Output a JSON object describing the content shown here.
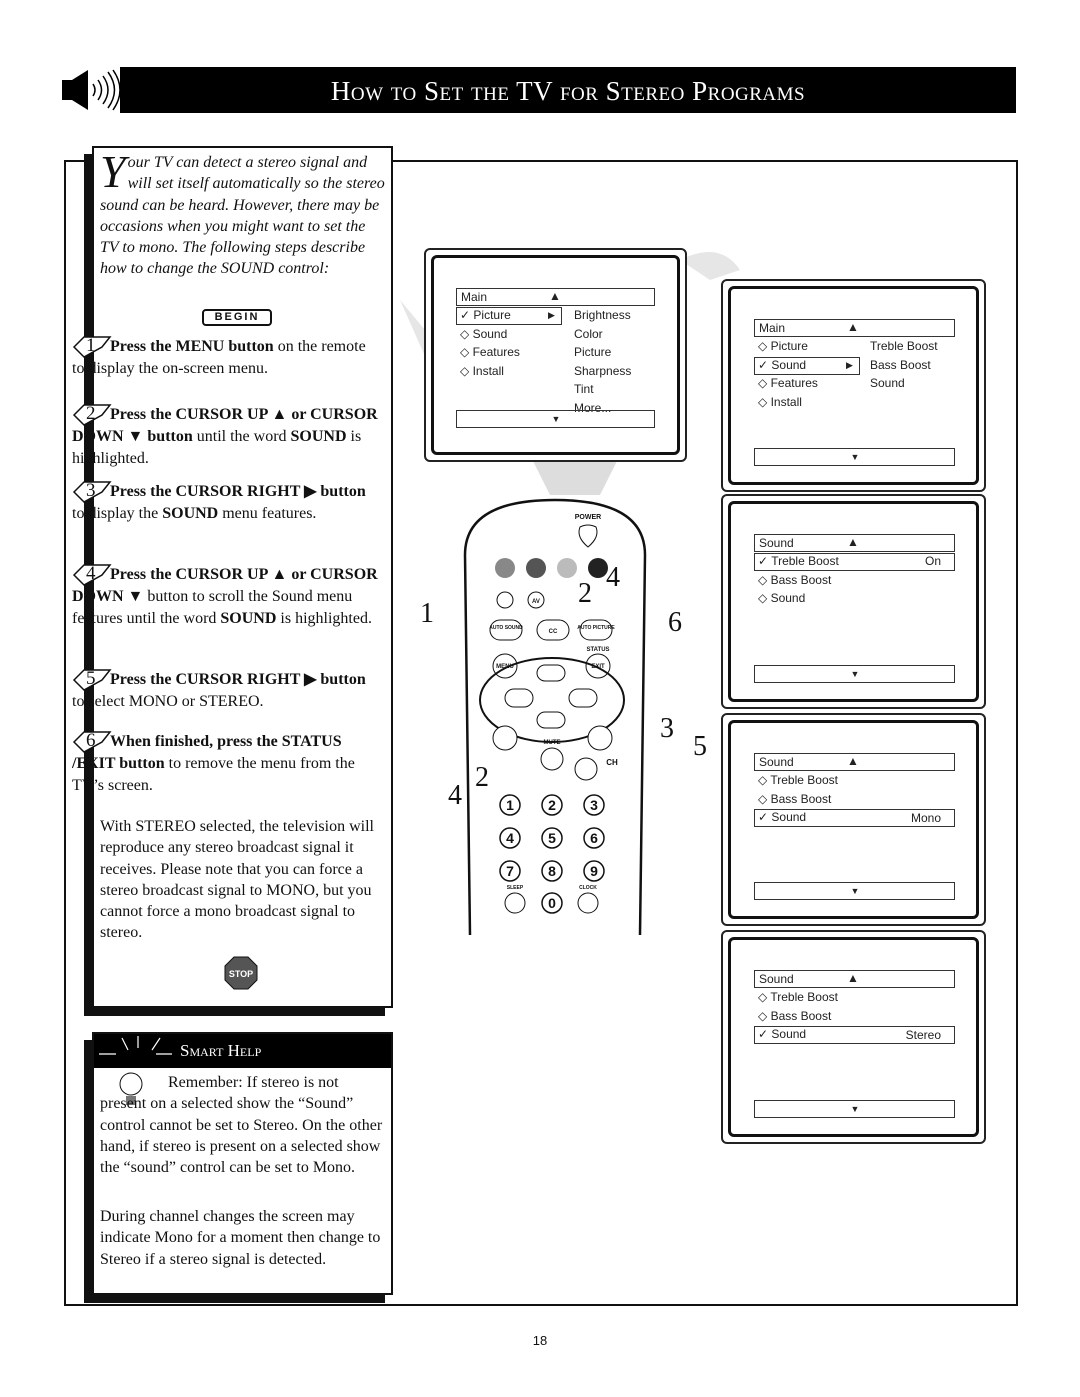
{
  "header": {
    "title": "How to Set the TV for Stereo Programs",
    "icon": "speaker-icon"
  },
  "intro": {
    "dropcap": "Y",
    "text": "our TV can detect a stereo signal and will set itself automatically so the stereo sound can be heard. However, there may be occasions when you might want to set the TV to mono. The following steps describe how to change the SOUND control:"
  },
  "begin_label": "BEGIN",
  "steps": [
    {
      "num": "1",
      "bold": "Press the MENU button",
      "rest": " on the remote to display the on-screen menu."
    },
    {
      "num": "2",
      "bold": "Press the CURSOR UP ▲ or CURSOR DOWN ▼ button",
      "rest": " until the word ",
      "bold2": "SOUND",
      "rest2": " is highlighted."
    },
    {
      "num": "3",
      "bold": "Press the CURSOR RIGHT ▶ button",
      "rest": " to display the ",
      "bold2": "SOUND",
      "rest2": " menu features."
    },
    {
      "num": "4",
      "bold": "Press the CURSOR UP ▲ or CURSOR DOWN ▼",
      "rest": " button to scroll the Sound menu features until the word ",
      "bold2": "SOUND",
      "rest2": " is highlighted."
    },
    {
      "num": "5",
      "bold": "Press the CURSOR RIGHT ▶ button",
      "rest": " to select MONO or STEREO."
    },
    {
      "num": "6",
      "bold": "When finished, press the STATUS /EXIT button",
      "rest": " to remove the menu from the TV’s screen."
    }
  ],
  "note": "With STEREO selected, the television will reproduce any stereo broadcast signal it receives. Please note that you can force a stereo broadcast signal to MONO, but you cannot force a mono broadcast signal to stereo.",
  "stop_label": "STOP",
  "smart_help": {
    "title": "Smart Help",
    "p1": "Remember: If stereo is not present on a selected show the “Sound” control cannot be set to Stereo. On the other hand, if stereo is present on a selected show the “sound” control can be set to Mono.",
    "p2": "During channel changes the screen may indicate Mono for a moment then change to Stereo if a stereo signal is detected."
  },
  "screens": [
    {
      "header": "Main",
      "items": [
        "Picture",
        "Sound",
        "Features",
        "Install"
      ],
      "selected": 0,
      "sub": [
        "Brightness",
        "Color",
        "Picture",
        "Sharpness",
        "Tint",
        "More..."
      ]
    },
    {
      "header": "Main",
      "items": [
        "Picture",
        "Sound",
        "Features",
        "Install"
      ],
      "selected": 1,
      "sub": [
        "Treble Boost",
        "Bass Boost",
        "Sound"
      ]
    },
    {
      "header": "Sound",
      "items": [
        "Treble Boost",
        "Bass Boost",
        "Sound"
      ],
      "selected": 0,
      "value": "On"
    },
    {
      "header": "Sound",
      "items": [
        "Treble Boost",
        "Bass Boost",
        "Sound"
      ],
      "selected": 2,
      "value": "Mono"
    },
    {
      "header": "Sound",
      "items": [
        "Treble Boost",
        "Bass Boost",
        "Sound"
      ],
      "selected": 2,
      "value": "Stereo"
    }
  ],
  "remote": {
    "power": "POWER",
    "av": "AV",
    "auto_sound": "AUTO SOUND",
    "cc": "CC",
    "auto_picture": "AUTO PICTURE",
    "status": "STATUS",
    "menu": "MENU",
    "exit": "EXIT",
    "mute": "MUTE",
    "ch": "CH",
    "sleep": "SLEEP",
    "clock": "CLOCK",
    "digits": [
      "1",
      "2",
      "3",
      "4",
      "5",
      "6",
      "7",
      "8",
      "9",
      "0"
    ]
  },
  "callouts": [
    "1",
    "2",
    "4",
    "6",
    "3",
    "5",
    "4",
    "2"
  ],
  "page_number": "18"
}
